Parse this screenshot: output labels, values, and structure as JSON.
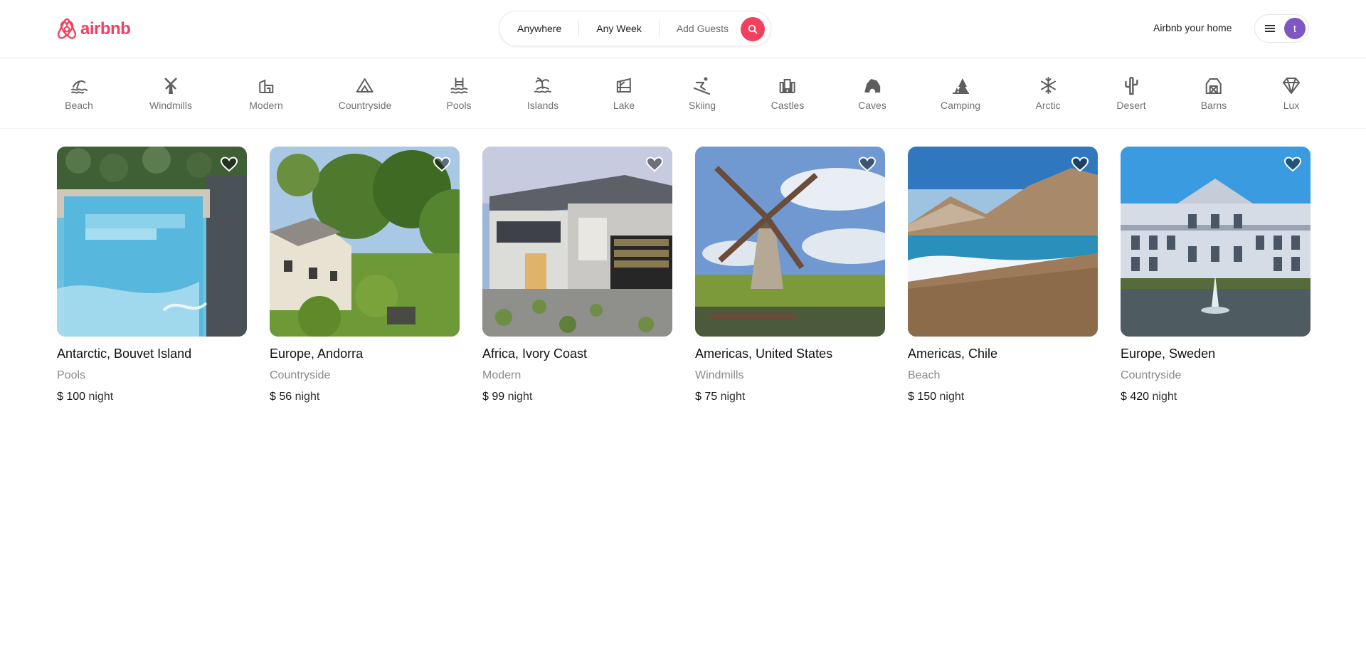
{
  "brand": {
    "name": "airbnb",
    "color": "#f43f5e"
  },
  "search": {
    "where": "Anywhere",
    "when": "Any Week",
    "guests": "Add Guests",
    "icon": "search-icon"
  },
  "header": {
    "host_link": "Airbnb your home",
    "menu_icon": "hamburger-icon",
    "avatar_initial": "t"
  },
  "categories": [
    {
      "label": "Beach",
      "icon": "beach-icon"
    },
    {
      "label": "Windmills",
      "icon": "windmill-icon"
    },
    {
      "label": "Modern",
      "icon": "modern-house-icon"
    },
    {
      "label": "Countryside",
      "icon": "mountain-icon"
    },
    {
      "label": "Pools",
      "icon": "pool-icon"
    },
    {
      "label": "Islands",
      "icon": "island-icon"
    },
    {
      "label": "Lake",
      "icon": "lake-icon"
    },
    {
      "label": "Skiing",
      "icon": "skiing-icon"
    },
    {
      "label": "Castles",
      "icon": "castle-icon"
    },
    {
      "label": "Caves",
      "icon": "cave-icon"
    },
    {
      "label": "Camping",
      "icon": "camping-icon"
    },
    {
      "label": "Arctic",
      "icon": "snowflake-icon"
    },
    {
      "label": "Desert",
      "icon": "cactus-icon"
    },
    {
      "label": "Barns",
      "icon": "barn-icon"
    },
    {
      "label": "Lux",
      "icon": "diamond-icon"
    }
  ],
  "listings": [
    {
      "location": "Antarctic, Bouvet Island",
      "category": "Pools",
      "price": "$ 100",
      "unit": "night"
    },
    {
      "location": "Europe, Andorra",
      "category": "Countryside",
      "price": "$ 56",
      "unit": "night"
    },
    {
      "location": "Africa, Ivory Coast",
      "category": "Modern",
      "price": "$ 99",
      "unit": "night"
    },
    {
      "location": "Americas, United States",
      "category": "Windmills",
      "price": "$ 75",
      "unit": "night"
    },
    {
      "location": "Americas, Chile",
      "category": "Beach",
      "price": "$ 150",
      "unit": "night"
    },
    {
      "location": "Europe, Sweden",
      "category": "Countryside",
      "price": "$ 420",
      "unit": "night"
    }
  ]
}
